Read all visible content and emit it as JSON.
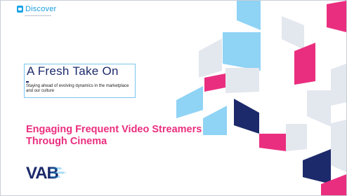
{
  "brand": {
    "discover_label": "Discover",
    "vab_logo": "VAB",
    "tagline": [
      "Insights.",
      "Inspiration.",
      "Impact."
    ]
  },
  "title_box": {
    "title": "A Fresh Take On",
    "subtitle": "Staying ahead of evolving dynamics in the marketplace and our culture"
  },
  "headline": "Engaging Frequent Video Streamers\nThrough Cinema",
  "colors": {
    "pink": "#ea2e7f",
    "navy": "#1c2a6b",
    "light_blue": "#8fd3f5",
    "light_grey": "#e3e7ee",
    "discover_blue": "#1a9de0"
  },
  "icons": {
    "discover": "discover-icon"
  }
}
